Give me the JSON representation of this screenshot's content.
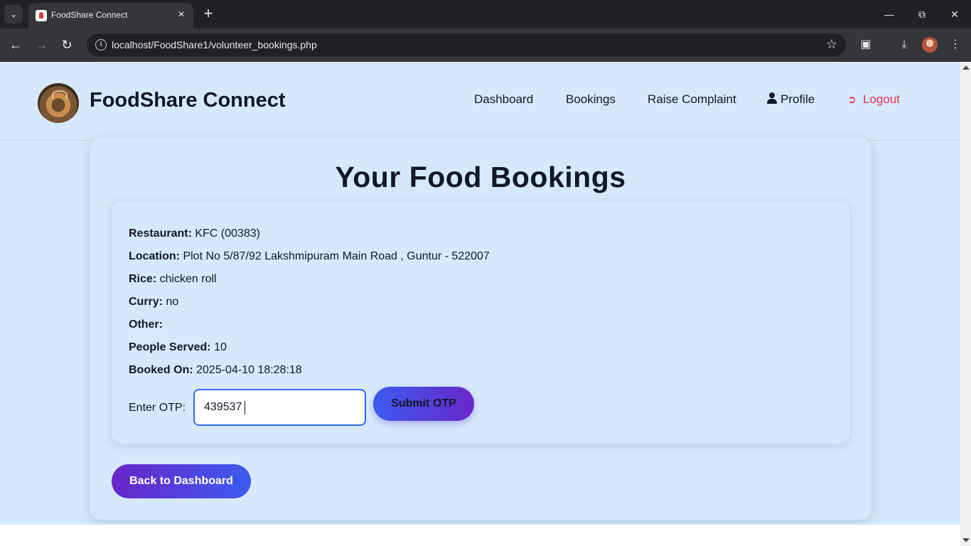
{
  "browser": {
    "tab_title": "FoodShare Connect",
    "new_tab_label": "+",
    "url": "localhost/FoodShare1/volunteer_bookings.php"
  },
  "header": {
    "brand": "FoodShare Connect",
    "nav": {
      "dashboard": "Dashboard",
      "bookings": "Bookings",
      "complaint": "Raise Complaint",
      "profile": "Profile",
      "logout": "Logout"
    }
  },
  "main": {
    "title": "Your Food Bookings",
    "booking": {
      "restaurant_label": "Restaurant:",
      "restaurant": "KFC (00383)",
      "location_label": "Location:",
      "location": "Plot No 5/87/92 Lakshmipuram Main Road , Guntur - 522007",
      "rice_label": "Rice:",
      "rice": "chicken roll",
      "curry_label": "Curry:",
      "curry": "no",
      "other_label": "Other:",
      "other": "",
      "people_label": "People Served:",
      "people": "10",
      "booked_label": "Booked On:",
      "booked": "2025-04-10 18:28:18",
      "otp_label": "Enter OTP:",
      "otp_value": "439537",
      "submit_label": "Submit OTP"
    },
    "back_label": "Back to Dashboard"
  },
  "colors": {
    "page_bg": "#d6e9fc",
    "logout": "#e0334a",
    "button_blue": "#3b5bf0",
    "button_purple": "#6a25c9"
  }
}
